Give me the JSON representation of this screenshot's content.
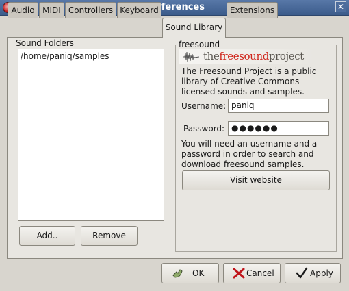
{
  "window": {
    "title": "Preferences",
    "close_glyph": "✕",
    "app_icon": "app-logo-icon"
  },
  "tabs": [
    {
      "label": "Audio"
    },
    {
      "label": "MIDI"
    },
    {
      "label": "Controllers"
    },
    {
      "label": "Keyboard"
    },
    {
      "label": "Sound Library",
      "active": true
    },
    {
      "label": "Extensions"
    }
  ],
  "sound_folders": {
    "label": "Sound Folders",
    "items": [
      "/home/paniq/samples"
    ],
    "add_button": "Add..",
    "remove_button": "Remove"
  },
  "freesound": {
    "label": "freesound",
    "logo_prefix": "the",
    "logo_highlight": "freesound",
    "logo_suffix": "project",
    "description": "The Freesound Project is a public library of Creative Commons licensed sounds and samples.",
    "username_label": "Username:",
    "username_value": "paniq",
    "password_label": "Password:",
    "password_dots": "●●●●●●",
    "note": "You will need an username and a password in order to search and download freesound samples.",
    "visit_button": "Visit website"
  },
  "dialog_buttons": {
    "ok": "OK",
    "cancel": "Cancel",
    "apply": "Apply"
  },
  "colors": {
    "titlebar": "#3b5b8a",
    "logo_highlight": "#d0261c",
    "window_bg": "#d8d5ce"
  }
}
